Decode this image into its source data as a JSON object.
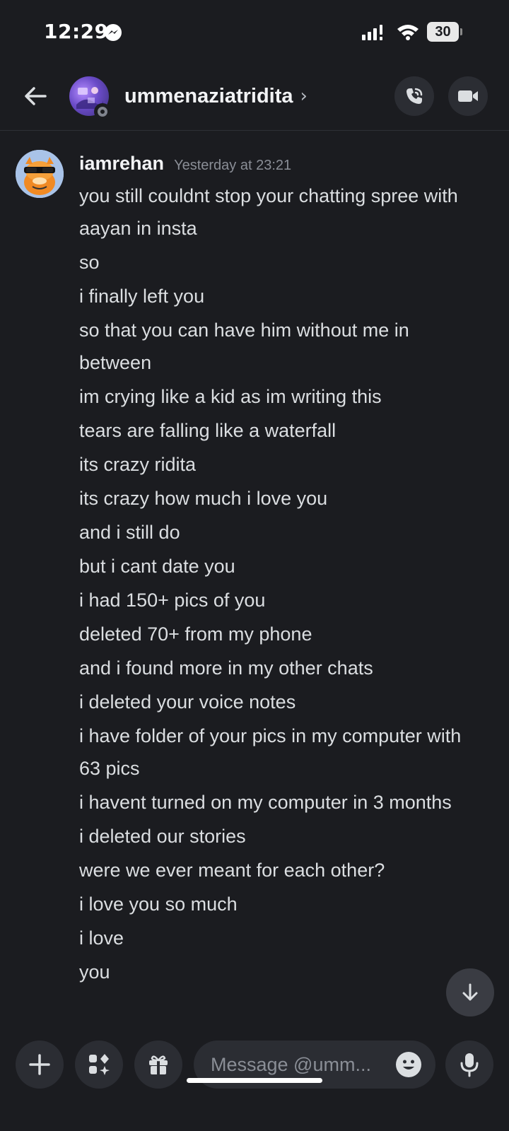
{
  "status_bar": {
    "time": "12:29",
    "battery": "30",
    "icons": [
      "messenger-icon",
      "signal-icon",
      "wifi-icon",
      "battery-icon"
    ]
  },
  "header": {
    "back_icon": "arrow-left-icon",
    "recipient_name": "ummenaziatridita",
    "chevron": "›",
    "status": "offline",
    "actions": [
      "phone-call-icon",
      "video-camera-icon"
    ]
  },
  "message": {
    "author": "iamrehan",
    "timestamp": "Yesterday at 23:21",
    "lines": [
      "you still couldnt stop your chatting spree with aayan in insta",
      "so",
      "i finally left you",
      "so that you can have him without me in between",
      "im crying like a kid as im writing this",
      "tears are falling like a waterfall",
      "its crazy ridita",
      "its crazy how much i love you",
      "and i still do",
      "but i cant date you",
      "i had 150+ pics of you",
      "deleted 70+ from my phone",
      "and i found more in my other chats",
      "i deleted your voice notes",
      "i have folder of your pics in my computer with 63 pics",
      "i havent turned on my computer in 3 months",
      "i deleted our stories",
      "were we ever meant for each other?",
      "i love you so much",
      "i love",
      "you"
    ]
  },
  "composer": {
    "placeholder": "Message @umm...",
    "buttons": [
      "plus-icon",
      "apps-icon",
      "gift-icon",
      "emoji-icon",
      "microphone-icon"
    ]
  },
  "colors": {
    "background": "#1b1c20",
    "surface": "#2b2d33",
    "text": "#dbdee1",
    "muted": "#8a8e96"
  }
}
